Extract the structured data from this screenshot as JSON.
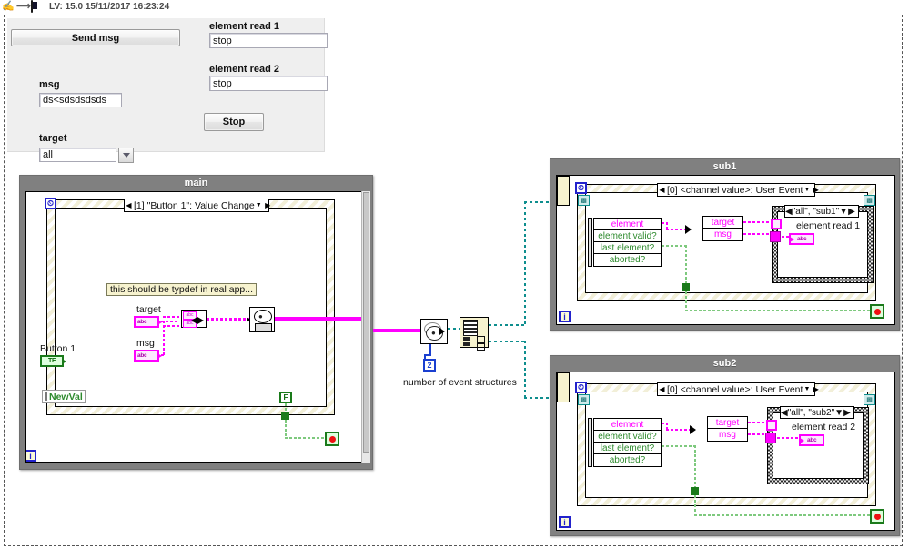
{
  "titlebar": {
    "hand_icon": "hand-cursor-icon",
    "arrow_icon": "right-arrow-icon",
    "app_icon": "labview-logo-icon",
    "text": "LV: 15.0 15/11/2017 16:23:24"
  },
  "front_panel": {
    "send_button": "Send msg",
    "msg_label": "msg",
    "msg_value": "ds<sdsdsdsds",
    "target_label": "target",
    "target_value": "all",
    "element_read_1_label": "element read 1",
    "element_read_1_value": "stop",
    "element_read_2_label": "element read 2",
    "element_read_2_value": "stop",
    "stop_button": "Stop"
  },
  "main_window": {
    "title": "main",
    "event_case": "[1] \"Button 1\": Value Change",
    "event_case_index": "[1]",
    "event_case_name": "\"Button 1\": Value Change",
    "comment": "this should be typdef in real app...",
    "target_label": "target",
    "msg_label": "msg",
    "button1_label": "Button 1",
    "button1_glyph": "TF",
    "newval_label": "NewVal",
    "str_glyph": "abc",
    "false_constant": "F",
    "info_badge": "i",
    "stop_led": "stop-led-icon"
  },
  "middle": {
    "num_event_structures_value": "2",
    "num_event_structures_caption": "number of event structures",
    "create_channel_icon": "create-user-event-icon",
    "channel_writer_icon": "channel-writer-icon"
  },
  "sub1": {
    "title": "sub1",
    "event_case": "[0] <channel value>: User Event",
    "event_case_index": "[0]",
    "event_case_name": "<channel value>: User Event",
    "cluster_items": [
      "element",
      "element valid?",
      "last element?",
      "aborted?"
    ],
    "bundle_items": [
      "target",
      "msg"
    ],
    "case_selector": "\"all\", \"sub1\"",
    "indicator_label": "element read 1",
    "str_glyph": "abc",
    "info_badge": "i",
    "stop_led": "stop-led-icon"
  },
  "sub2": {
    "title": "sub2",
    "event_case": "[0] <channel value>: User Event",
    "event_case_index": "[0]",
    "event_case_name": "<channel value>: User Event",
    "cluster_items": [
      "element",
      "element valid?",
      "last element?",
      "aborted?"
    ],
    "bundle_items": [
      "target",
      "msg"
    ],
    "case_selector": "\"all\", \"sub2\"",
    "indicator_label": "element read 2",
    "str_glyph": "abc",
    "info_badge": "i",
    "stop_led": "stop-led-icon"
  },
  "colors": {
    "string_wire": "#ff00ff",
    "bool_wire": "#7ec97e",
    "channel_wire": "#0e8e8e",
    "numeric_wire": "#1a3fd0",
    "window_chrome": "#808080",
    "event_frame": "#f2efd8"
  }
}
